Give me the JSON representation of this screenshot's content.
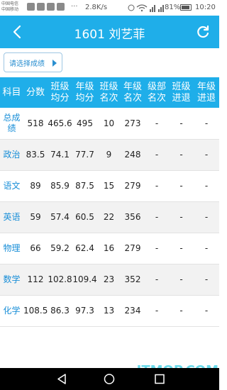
{
  "status_bar": {
    "carrier1": "中国电信",
    "carrier2": "中国移动",
    "overflow": "···",
    "speed": "2.8K/s",
    "battery": "81%",
    "time": "10:20"
  },
  "header": {
    "title": "1601 刘艺菲"
  },
  "select_button": {
    "label": "请选择成绩"
  },
  "table": {
    "headers": [
      [
        "科目"
      ],
      [
        "分数"
      ],
      [
        "班级",
        "均分"
      ],
      [
        "年级",
        "均分"
      ],
      [
        "班级",
        "名次"
      ],
      [
        "年级",
        "名次"
      ],
      [
        "级部",
        "名次"
      ],
      [
        "班级",
        "进退"
      ],
      [
        "年级",
        "进退"
      ]
    ],
    "rows": [
      {
        "subject": "总成绩",
        "score": "518",
        "class_avg": "465.6",
        "grade_avg": "495",
        "class_rank": "10",
        "grade_rank": "273",
        "dept_rank": "-",
        "class_change": "-",
        "grade_change": "-"
      },
      {
        "subject": "政治",
        "score": "83.5",
        "class_avg": "74.1",
        "grade_avg": "77.7",
        "class_rank": "9",
        "grade_rank": "248",
        "dept_rank": "-",
        "class_change": "-",
        "grade_change": "-"
      },
      {
        "subject": "语文",
        "score": "89",
        "class_avg": "85.9",
        "grade_avg": "87.5",
        "class_rank": "15",
        "grade_rank": "279",
        "dept_rank": "-",
        "class_change": "-",
        "grade_change": "-"
      },
      {
        "subject": "英语",
        "score": "59",
        "class_avg": "57.4",
        "grade_avg": "60.5",
        "class_rank": "22",
        "grade_rank": "356",
        "dept_rank": "-",
        "class_change": "-",
        "grade_change": "-"
      },
      {
        "subject": "物理",
        "score": "66",
        "class_avg": "59.2",
        "grade_avg": "62.4",
        "class_rank": "16",
        "grade_rank": "279",
        "dept_rank": "-",
        "class_change": "-",
        "grade_change": "-"
      },
      {
        "subject": "数学",
        "score": "112",
        "class_avg": "102.8",
        "grade_avg": "109.4",
        "class_rank": "23",
        "grade_rank": "352",
        "dept_rank": "-",
        "class_change": "-",
        "grade_change": "-"
      },
      {
        "subject": "化学",
        "score": "108.5",
        "class_avg": "86.3",
        "grade_avg": "97.3",
        "class_rank": "13",
        "grade_rank": "234",
        "dept_rank": "-",
        "class_change": "-",
        "grade_change": "-"
      }
    ]
  },
  "watermark": "ITMOP.COM",
  "colors": {
    "accent": "#1faee9",
    "link": "#1a8fd8"
  },
  "icons": {
    "back": "chevron-left-icon",
    "refresh": "refresh-icon",
    "dropdown": "triangle-right-icon"
  }
}
